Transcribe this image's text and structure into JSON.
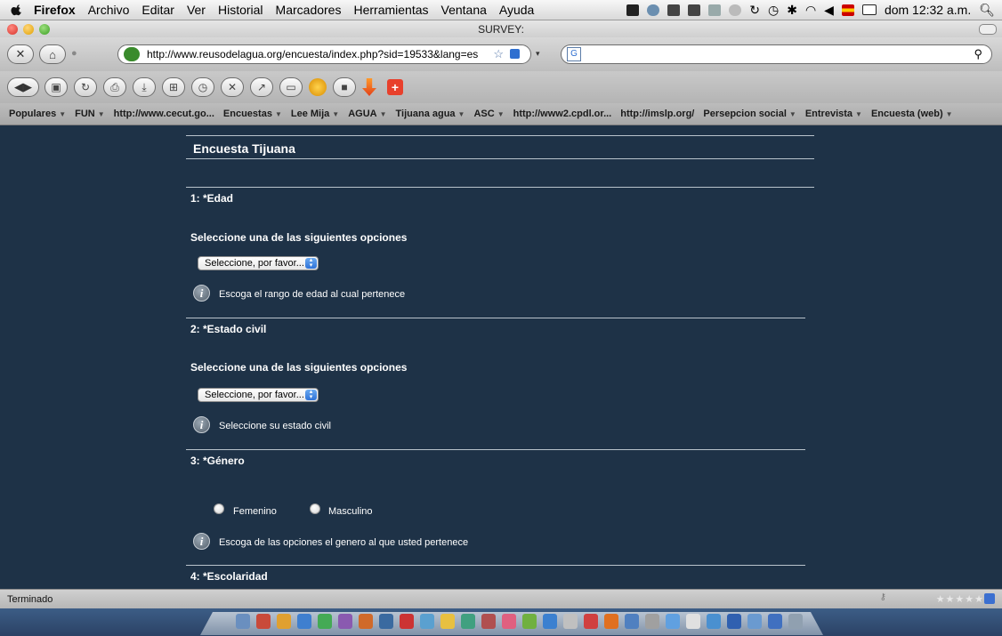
{
  "menubar": {
    "app_name": "Firefox",
    "items": [
      "Archivo",
      "Editar",
      "Ver",
      "Historial",
      "Marcadores",
      "Herramientas",
      "Ventana",
      "Ayuda"
    ],
    "clock": "dom 12:32 a.m."
  },
  "window": {
    "title": "SURVEY:"
  },
  "navbar": {
    "url": "http://www.reusodelagua.org/encuesta/index.php?sid=19533&lang=es",
    "search_value": ""
  },
  "bookmarks": [
    {
      "label": "Populares",
      "menu": true
    },
    {
      "label": "FUN",
      "menu": true
    },
    {
      "label": "http://www.cecut.go...",
      "menu": false
    },
    {
      "label": "Encuestas",
      "menu": true
    },
    {
      "label": "Lee Mija",
      "menu": true
    },
    {
      "label": "AGUA",
      "menu": true
    },
    {
      "label": "Tijuana agua",
      "menu": true
    },
    {
      "label": "ASC",
      "menu": true
    },
    {
      "label": "http://www2.cpdl.or...",
      "menu": false
    },
    {
      "label": "http://imslp.org/",
      "menu": false
    },
    {
      "label": "Persepcion social",
      "menu": true
    },
    {
      "label": "Entrevista",
      "menu": true
    },
    {
      "label": "Encuesta (web)",
      "menu": true
    }
  ],
  "survey": {
    "title": "Encuesta Tijuana",
    "questions": [
      {
        "label": "1: *Edad",
        "instruction": "Seleccione una de las siguientes opciones",
        "select_value": "Seleccione, por favor...",
        "help": "Escoga el rango de edad al cual pertenece"
      },
      {
        "label": "2: *Estado civil",
        "instruction": "Seleccione una de las siguientes opciones",
        "select_value": "Seleccione, por favor...",
        "help": "Seleccione su estado civil"
      },
      {
        "label": "3: *Género",
        "options": [
          "Femenino",
          "Masculino"
        ],
        "help": "Escoga de las opciones el genero al que usted pertenece"
      },
      {
        "label": "4: *Escolaridad"
      }
    ]
  },
  "statusbar": {
    "text": "Terminado"
  }
}
